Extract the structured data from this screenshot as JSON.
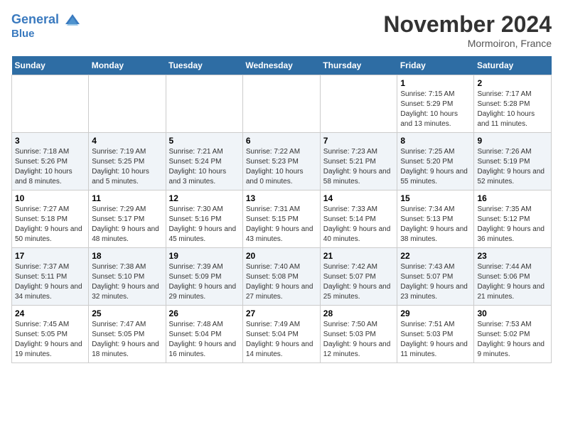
{
  "header": {
    "logo_line1": "General",
    "logo_line2": "Blue",
    "month_title": "November 2024",
    "location": "Mormoiron, France"
  },
  "columns": [
    "Sunday",
    "Monday",
    "Tuesday",
    "Wednesday",
    "Thursday",
    "Friday",
    "Saturday"
  ],
  "weeks": [
    [
      {
        "day": "",
        "info": ""
      },
      {
        "day": "",
        "info": ""
      },
      {
        "day": "",
        "info": ""
      },
      {
        "day": "",
        "info": ""
      },
      {
        "day": "",
        "info": ""
      },
      {
        "day": "1",
        "info": "Sunrise: 7:15 AM\nSunset: 5:29 PM\nDaylight: 10 hours and 13 minutes."
      },
      {
        "day": "2",
        "info": "Sunrise: 7:17 AM\nSunset: 5:28 PM\nDaylight: 10 hours and 11 minutes."
      }
    ],
    [
      {
        "day": "3",
        "info": "Sunrise: 7:18 AM\nSunset: 5:26 PM\nDaylight: 10 hours and 8 minutes."
      },
      {
        "day": "4",
        "info": "Sunrise: 7:19 AM\nSunset: 5:25 PM\nDaylight: 10 hours and 5 minutes."
      },
      {
        "day": "5",
        "info": "Sunrise: 7:21 AM\nSunset: 5:24 PM\nDaylight: 10 hours and 3 minutes."
      },
      {
        "day": "6",
        "info": "Sunrise: 7:22 AM\nSunset: 5:23 PM\nDaylight: 10 hours and 0 minutes."
      },
      {
        "day": "7",
        "info": "Sunrise: 7:23 AM\nSunset: 5:21 PM\nDaylight: 9 hours and 58 minutes."
      },
      {
        "day": "8",
        "info": "Sunrise: 7:25 AM\nSunset: 5:20 PM\nDaylight: 9 hours and 55 minutes."
      },
      {
        "day": "9",
        "info": "Sunrise: 7:26 AM\nSunset: 5:19 PM\nDaylight: 9 hours and 52 minutes."
      }
    ],
    [
      {
        "day": "10",
        "info": "Sunrise: 7:27 AM\nSunset: 5:18 PM\nDaylight: 9 hours and 50 minutes."
      },
      {
        "day": "11",
        "info": "Sunrise: 7:29 AM\nSunset: 5:17 PM\nDaylight: 9 hours and 48 minutes."
      },
      {
        "day": "12",
        "info": "Sunrise: 7:30 AM\nSunset: 5:16 PM\nDaylight: 9 hours and 45 minutes."
      },
      {
        "day": "13",
        "info": "Sunrise: 7:31 AM\nSunset: 5:15 PM\nDaylight: 9 hours and 43 minutes."
      },
      {
        "day": "14",
        "info": "Sunrise: 7:33 AM\nSunset: 5:14 PM\nDaylight: 9 hours and 40 minutes."
      },
      {
        "day": "15",
        "info": "Sunrise: 7:34 AM\nSunset: 5:13 PM\nDaylight: 9 hours and 38 minutes."
      },
      {
        "day": "16",
        "info": "Sunrise: 7:35 AM\nSunset: 5:12 PM\nDaylight: 9 hours and 36 minutes."
      }
    ],
    [
      {
        "day": "17",
        "info": "Sunrise: 7:37 AM\nSunset: 5:11 PM\nDaylight: 9 hours and 34 minutes."
      },
      {
        "day": "18",
        "info": "Sunrise: 7:38 AM\nSunset: 5:10 PM\nDaylight: 9 hours and 32 minutes."
      },
      {
        "day": "19",
        "info": "Sunrise: 7:39 AM\nSunset: 5:09 PM\nDaylight: 9 hours and 29 minutes."
      },
      {
        "day": "20",
        "info": "Sunrise: 7:40 AM\nSunset: 5:08 PM\nDaylight: 9 hours and 27 minutes."
      },
      {
        "day": "21",
        "info": "Sunrise: 7:42 AM\nSunset: 5:07 PM\nDaylight: 9 hours and 25 minutes."
      },
      {
        "day": "22",
        "info": "Sunrise: 7:43 AM\nSunset: 5:07 PM\nDaylight: 9 hours and 23 minutes."
      },
      {
        "day": "23",
        "info": "Sunrise: 7:44 AM\nSunset: 5:06 PM\nDaylight: 9 hours and 21 minutes."
      }
    ],
    [
      {
        "day": "24",
        "info": "Sunrise: 7:45 AM\nSunset: 5:05 PM\nDaylight: 9 hours and 19 minutes."
      },
      {
        "day": "25",
        "info": "Sunrise: 7:47 AM\nSunset: 5:05 PM\nDaylight: 9 hours and 18 minutes."
      },
      {
        "day": "26",
        "info": "Sunrise: 7:48 AM\nSunset: 5:04 PM\nDaylight: 9 hours and 16 minutes."
      },
      {
        "day": "27",
        "info": "Sunrise: 7:49 AM\nSunset: 5:04 PM\nDaylight: 9 hours and 14 minutes."
      },
      {
        "day": "28",
        "info": "Sunrise: 7:50 AM\nSunset: 5:03 PM\nDaylight: 9 hours and 12 minutes."
      },
      {
        "day": "29",
        "info": "Sunrise: 7:51 AM\nSunset: 5:03 PM\nDaylight: 9 hours and 11 minutes."
      },
      {
        "day": "30",
        "info": "Sunrise: 7:53 AM\nSunset: 5:02 PM\nDaylight: 9 hours and 9 minutes."
      }
    ]
  ]
}
